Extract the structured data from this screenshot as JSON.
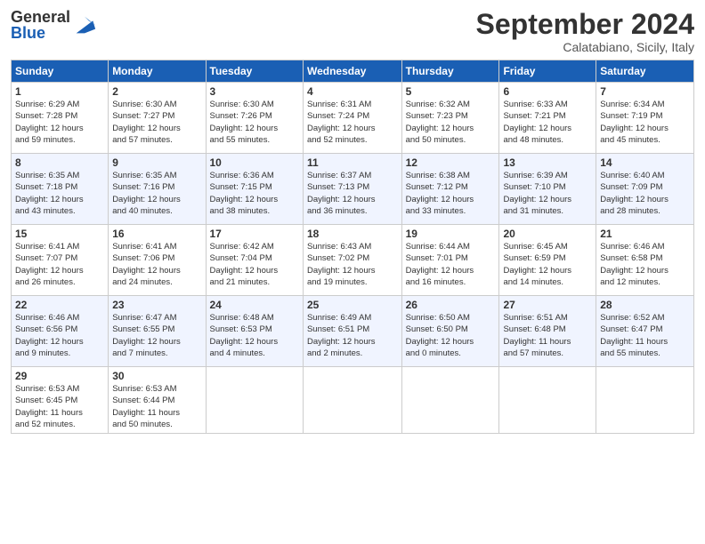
{
  "header": {
    "logo_general": "General",
    "logo_blue": "Blue",
    "month": "September 2024",
    "location": "Calatabiano, Sicily, Italy"
  },
  "days_of_week": [
    "Sunday",
    "Monday",
    "Tuesday",
    "Wednesday",
    "Thursday",
    "Friday",
    "Saturday"
  ],
  "weeks": [
    [
      {
        "day": 1,
        "sunrise": "6:29 AM",
        "sunset": "7:28 PM",
        "daylight": "12 hours and 59 minutes."
      },
      {
        "day": 2,
        "sunrise": "6:30 AM",
        "sunset": "7:27 PM",
        "daylight": "12 hours and 57 minutes."
      },
      {
        "day": 3,
        "sunrise": "6:30 AM",
        "sunset": "7:26 PM",
        "daylight": "12 hours and 55 minutes."
      },
      {
        "day": 4,
        "sunrise": "6:31 AM",
        "sunset": "7:24 PM",
        "daylight": "12 hours and 52 minutes."
      },
      {
        "day": 5,
        "sunrise": "6:32 AM",
        "sunset": "7:23 PM",
        "daylight": "12 hours and 50 minutes."
      },
      {
        "day": 6,
        "sunrise": "6:33 AM",
        "sunset": "7:21 PM",
        "daylight": "12 hours and 48 minutes."
      },
      {
        "day": 7,
        "sunrise": "6:34 AM",
        "sunset": "7:19 PM",
        "daylight": "12 hours and 45 minutes."
      }
    ],
    [
      {
        "day": 8,
        "sunrise": "6:35 AM",
        "sunset": "7:18 PM",
        "daylight": "12 hours and 43 minutes."
      },
      {
        "day": 9,
        "sunrise": "6:35 AM",
        "sunset": "7:16 PM",
        "daylight": "12 hours and 40 minutes."
      },
      {
        "day": 10,
        "sunrise": "6:36 AM",
        "sunset": "7:15 PM",
        "daylight": "12 hours and 38 minutes."
      },
      {
        "day": 11,
        "sunrise": "6:37 AM",
        "sunset": "7:13 PM",
        "daylight": "12 hours and 36 minutes."
      },
      {
        "day": 12,
        "sunrise": "6:38 AM",
        "sunset": "7:12 PM",
        "daylight": "12 hours and 33 minutes."
      },
      {
        "day": 13,
        "sunrise": "6:39 AM",
        "sunset": "7:10 PM",
        "daylight": "12 hours and 31 minutes."
      },
      {
        "day": 14,
        "sunrise": "6:40 AM",
        "sunset": "7:09 PM",
        "daylight": "12 hours and 28 minutes."
      }
    ],
    [
      {
        "day": 15,
        "sunrise": "6:41 AM",
        "sunset": "7:07 PM",
        "daylight": "12 hours and 26 minutes."
      },
      {
        "day": 16,
        "sunrise": "6:41 AM",
        "sunset": "7:06 PM",
        "daylight": "12 hours and 24 minutes."
      },
      {
        "day": 17,
        "sunrise": "6:42 AM",
        "sunset": "7:04 PM",
        "daylight": "12 hours and 21 minutes."
      },
      {
        "day": 18,
        "sunrise": "6:43 AM",
        "sunset": "7:02 PM",
        "daylight": "12 hours and 19 minutes."
      },
      {
        "day": 19,
        "sunrise": "6:44 AM",
        "sunset": "7:01 PM",
        "daylight": "12 hours and 16 minutes."
      },
      {
        "day": 20,
        "sunrise": "6:45 AM",
        "sunset": "6:59 PM",
        "daylight": "12 hours and 14 minutes."
      },
      {
        "day": 21,
        "sunrise": "6:46 AM",
        "sunset": "6:58 PM",
        "daylight": "12 hours and 12 minutes."
      }
    ],
    [
      {
        "day": 22,
        "sunrise": "6:46 AM",
        "sunset": "6:56 PM",
        "daylight": "12 hours and 9 minutes."
      },
      {
        "day": 23,
        "sunrise": "6:47 AM",
        "sunset": "6:55 PM",
        "daylight": "12 hours and 7 minutes."
      },
      {
        "day": 24,
        "sunrise": "6:48 AM",
        "sunset": "6:53 PM",
        "daylight": "12 hours and 4 minutes."
      },
      {
        "day": 25,
        "sunrise": "6:49 AM",
        "sunset": "6:51 PM",
        "daylight": "12 hours and 2 minutes."
      },
      {
        "day": 26,
        "sunrise": "6:50 AM",
        "sunset": "6:50 PM",
        "daylight": "12 hours and 0 minutes."
      },
      {
        "day": 27,
        "sunrise": "6:51 AM",
        "sunset": "6:48 PM",
        "daylight": "11 hours and 57 minutes."
      },
      {
        "day": 28,
        "sunrise": "6:52 AM",
        "sunset": "6:47 PM",
        "daylight": "11 hours and 55 minutes."
      }
    ],
    [
      {
        "day": 29,
        "sunrise": "6:53 AM",
        "sunset": "6:45 PM",
        "daylight": "11 hours and 52 minutes."
      },
      {
        "day": 30,
        "sunrise": "6:53 AM",
        "sunset": "6:44 PM",
        "daylight": "11 hours and 50 minutes."
      },
      null,
      null,
      null,
      null,
      null
    ]
  ]
}
